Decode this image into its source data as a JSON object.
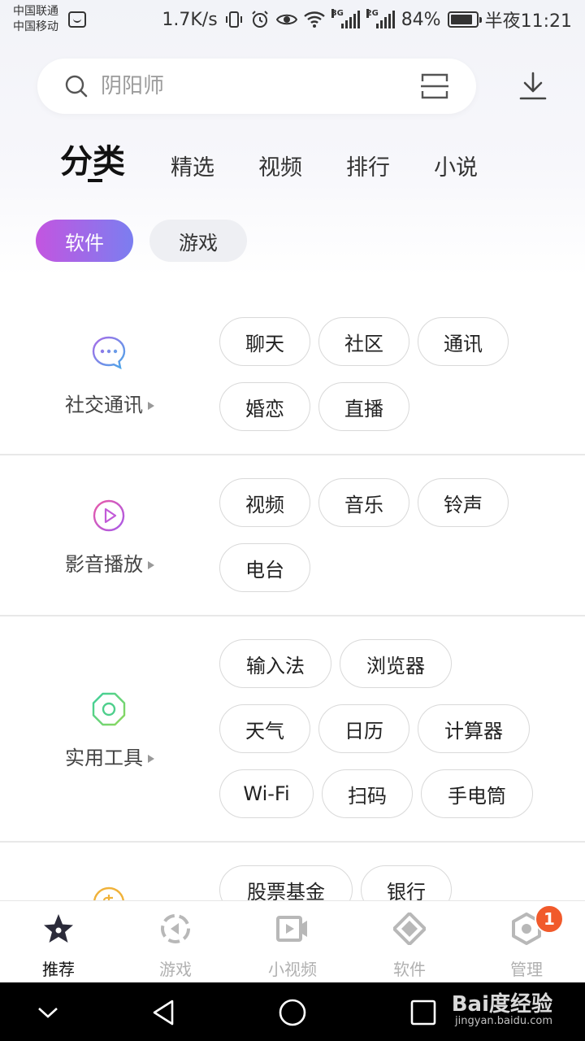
{
  "status_bar": {
    "carrier_1": "中国联通",
    "carrier_2": "中国移动",
    "speed": "1.7K/s",
    "net_1": "3G",
    "net_2": "2G",
    "battery": "84%",
    "time": "半夜11:21"
  },
  "search": {
    "placeholder": "阴阳师"
  },
  "tabs": [
    {
      "label": "分类"
    },
    {
      "label": "精选"
    },
    {
      "label": "视频"
    },
    {
      "label": "排行"
    },
    {
      "label": "小说"
    }
  ],
  "segments": {
    "software": "软件",
    "games": "游戏"
  },
  "categories": [
    {
      "title": "社交通讯",
      "icon": "chat-bubble-icon",
      "tags": [
        "聊天",
        "社区",
        "通讯",
        "婚恋",
        "直播"
      ]
    },
    {
      "title": "影音播放",
      "icon": "play-icon",
      "tags": [
        "视频",
        "音乐",
        "铃声",
        "电台"
      ]
    },
    {
      "title": "实用工具",
      "icon": "tools-octagon-icon",
      "tags": [
        "输入法",
        "浏览器",
        "天气",
        "日历",
        "计算器",
        "Wi-Fi",
        "扫码",
        "手电筒"
      ]
    },
    {
      "title": "",
      "icon": "coin-icon",
      "tags": [
        "股票基金",
        "银行"
      ]
    }
  ],
  "bottom_nav": [
    {
      "label": "推荐",
      "icon": "star-icon"
    },
    {
      "label": "游戏",
      "icon": "game-icon"
    },
    {
      "label": "小视频",
      "icon": "video-camera-icon"
    },
    {
      "label": "软件",
      "icon": "software-icon"
    },
    {
      "label": "管理",
      "icon": "manage-icon"
    }
  ],
  "manage_badge": "1",
  "watermark": {
    "text": "Bai度经验",
    "sub": "jingyan.baidu.com"
  },
  "colors": {
    "accent_start": "#c355e0",
    "accent_end": "#7b7ef0",
    "badge": "#f15a2b"
  }
}
